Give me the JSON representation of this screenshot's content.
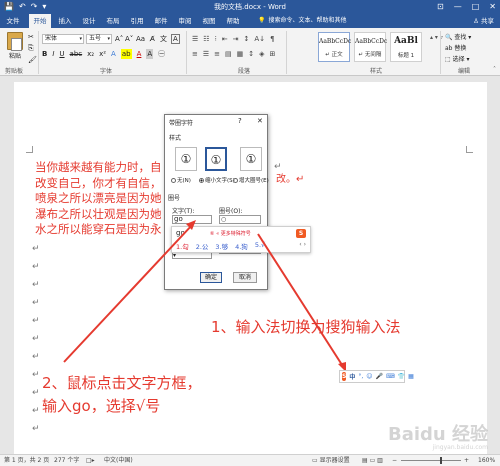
{
  "window": {
    "title": "我的文档.docx - Word",
    "qat": {
      "save": "💾",
      "undo": "↶",
      "redo": "↷",
      "customize": "▾"
    },
    "controls": {
      "ribbon_options": "⊡",
      "minimize": "—",
      "maximize": "□",
      "close": "✕"
    }
  },
  "tabs": [
    "文件",
    "开始",
    "插入",
    "设计",
    "布局",
    "引用",
    "邮件",
    "审阅",
    "视图",
    "帮助"
  ],
  "tell_me": {
    "icon": "💡",
    "text": "搜索命令、文本、帮助和其他"
  },
  "share": "♙ 共享",
  "ribbon": {
    "clipboard": {
      "paste": "粘贴",
      "cut": "✂",
      "copy": "⎘",
      "format_painter": "🖌",
      "label": "剪贴板"
    },
    "font": {
      "name": "宋体",
      "size": "五号",
      "grow": "A˄",
      "shrink": "A˅",
      "case": "Aa",
      "clear": "A̸",
      "phonetic": "文",
      "border": "A",
      "bold": "B",
      "italic": "I",
      "underline": "U",
      "strike": "abc",
      "sub": "x₂",
      "sup": "x²",
      "effects": "A",
      "highlight": "ab",
      "color": "A",
      "shade": "A",
      "circle": "㊀",
      "label": "字体"
    },
    "paragraph": {
      "row1": [
        "☰",
        "☷",
        "⁝",
        "⇤",
        "⇥",
        "↕",
        "A↓",
        "¶"
      ],
      "row2": [
        "≡",
        "☰",
        "≡",
        "▤",
        "▦",
        "↕",
        "◈",
        "⊞"
      ],
      "label": "段落"
    },
    "styles": {
      "items": [
        {
          "sample": "AaBbCcDc",
          "name": "↵ 正文"
        },
        {
          "sample": "AaBbCcDc",
          "name": "↵ 无间隔"
        },
        {
          "sample": "AaBl",
          "name": "标题 1"
        }
      ],
      "scroll": "▴ ▾ ▿",
      "label": "样式"
    },
    "editing": {
      "find": "🔍 查找 ▾",
      "replace": "ab 替换",
      "select": "⬚ 选择 ▾",
      "label": "编辑",
      "collapse": "˄"
    }
  },
  "document": {
    "lines": [
      "当你越来越有能力时，自",
      "改变自己，你才有自信，",
      "喷泉之所以漂亮是因为她",
      "瀑布之所以壮观是因为她",
      "水之所以能穿石是因为永"
    ],
    "right_fragment": "改。↵",
    "para_mark": "↵"
  },
  "dialog": {
    "title": "带圈字符",
    "help": "?",
    "close": "✕",
    "style_section": "样式",
    "options": [
      {
        "glyph": "①",
        "label": "无(N)"
      },
      {
        "glyph": "①",
        "label": "缩小文字(S)"
      },
      {
        "glyph": "①",
        "label": "增大圈号(E)"
      }
    ],
    "encl_section": "圈号",
    "text_label": "文字(T):",
    "enclosure_label": "圈号(O):",
    "text_value": "go",
    "enclosure_value": "○",
    "enclosure_list": [
      "○",
      "□",
      "△",
      "◇"
    ],
    "ok": "确定",
    "cancel": "取消"
  },
  "ime": {
    "composition": "go",
    "hint": "⑥ « 更多特殊符号",
    "logo": "S",
    "candidates": [
      "1.勾",
      "2.公",
      "3.够",
      "4.狗",
      "5.√"
    ],
    "nav": "‹ ›"
  },
  "annotations": {
    "step1": "1、输入法切换为搜狗输入法",
    "step2_line1": "2、鼠标点击文字方框，",
    "step2_line2": "输入go，选择√号"
  },
  "sogou_bar": {
    "logo": "S",
    "mode": "中",
    "punct": "°,",
    "emoji": "☺",
    "voice": "🎤",
    "keyboard": "⌨",
    "skin": "👕",
    "tools": "▦"
  },
  "statusbar": {
    "page": "第 1 页，共 2 页",
    "words": "277 个字",
    "proof": "□▸",
    "lang": "中文(中国)",
    "display": "▭ 显示器设置",
    "views": "▤ ▭ ▥",
    "zoom_minus": "−",
    "zoom_plus": "+",
    "zoom": "160%"
  },
  "watermark": {
    "text": "Baidu 经验",
    "sub": "jingyan.baidu.com"
  }
}
